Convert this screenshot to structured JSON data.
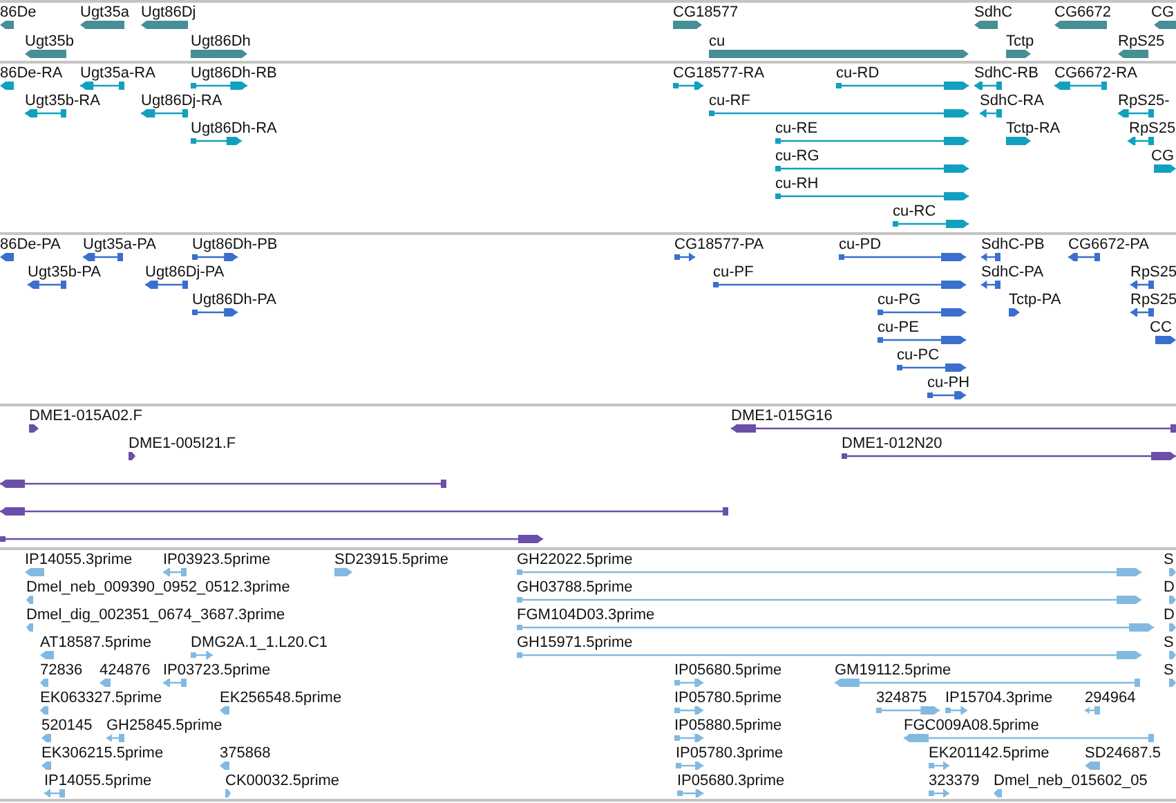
{
  "tracks": [
    {
      "kind": "gene",
      "features": [
        {
          "label": "86De",
          "reverse": true,
          "kind": "block"
        },
        {
          "label": "Ugt35a",
          "reverse": true,
          "kind": "block"
        },
        {
          "label": "Ugt86Dj",
          "reverse": true,
          "kind": "block"
        },
        {
          "label": "CG18577",
          "reverse": false,
          "kind": "block"
        },
        {
          "label": "SdhC",
          "reverse": true,
          "kind": "block"
        },
        {
          "label": "CG6672",
          "reverse": true,
          "kind": "block"
        },
        {
          "label": "CG",
          "reverse": true,
          "kind": "block"
        },
        {
          "label": "Ugt35b",
          "reverse": true,
          "kind": "block"
        },
        {
          "label": "Ugt86Dh",
          "reverse": false,
          "kind": "block"
        },
        {
          "label": "cu",
          "reverse": false,
          "kind": "block"
        },
        {
          "label": "Tctp",
          "reverse": false,
          "kind": "block"
        },
        {
          "label": "RpS25",
          "reverse": true,
          "kind": "block"
        }
      ]
    },
    {
      "kind": "mrna",
      "features": [
        {
          "label": "86De-RA",
          "reverse": true,
          "kind": "block"
        },
        {
          "label": "Ugt35a-RA",
          "reverse": true,
          "kind": "spliced"
        },
        {
          "label": "Ugt86Dh-RB",
          "reverse": false,
          "kind": "spliced"
        },
        {
          "label": "CG18577-RA",
          "reverse": false,
          "kind": "spliced"
        },
        {
          "label": "cu-RD",
          "reverse": false,
          "kind": "spliced"
        },
        {
          "label": "SdhC-RB",
          "reverse": true,
          "kind": "spliced"
        },
        {
          "label": "CG6672-RA",
          "reverse": true,
          "kind": "spliced"
        },
        {
          "label": "Ugt35b-RA",
          "reverse": true,
          "kind": "spliced"
        },
        {
          "label": "Ugt86Dj-RA",
          "reverse": true,
          "kind": "spliced"
        },
        {
          "label": "cu-RF",
          "reverse": false,
          "kind": "spliced"
        },
        {
          "label": "SdhC-RA",
          "reverse": true,
          "kind": "spliced"
        },
        {
          "label": "RpS25-",
          "reverse": true,
          "kind": "spliced"
        },
        {
          "label": "Ugt86Dh-RA",
          "reverse": false,
          "kind": "spliced"
        },
        {
          "label": "cu-RE",
          "reverse": false,
          "kind": "spliced"
        },
        {
          "label": "Tctp-RA",
          "reverse": false,
          "kind": "block"
        },
        {
          "label": "RpS25",
          "reverse": true,
          "kind": "spliced"
        },
        {
          "label": "cu-RG",
          "reverse": false,
          "kind": "spliced"
        },
        {
          "label": "CG",
          "reverse": false,
          "kind": "block"
        },
        {
          "label": "cu-RH",
          "reverse": false,
          "kind": "spliced"
        },
        {
          "label": "cu-RC",
          "reverse": false,
          "kind": "spliced"
        }
      ]
    },
    {
      "kind": "protein",
      "features": [
        {
          "label": "86De-PA",
          "reverse": true,
          "kind": "block"
        },
        {
          "label": "Ugt35a-PA",
          "reverse": true,
          "kind": "spliced"
        },
        {
          "label": "Ugt86Dh-PB",
          "reverse": false,
          "kind": "spliced"
        },
        {
          "label": "CG18577-PA",
          "reverse": false,
          "kind": "spliced"
        },
        {
          "label": "cu-PD",
          "reverse": false,
          "kind": "spliced"
        },
        {
          "label": "SdhC-PB",
          "reverse": true,
          "kind": "spliced"
        },
        {
          "label": "CG6672-PA",
          "reverse": true,
          "kind": "spliced"
        },
        {
          "label": "Ugt35b-PA",
          "reverse": true,
          "kind": "spliced"
        },
        {
          "label": "Ugt86Dj-PA",
          "reverse": true,
          "kind": "spliced"
        },
        {
          "label": "cu-PF",
          "reverse": false,
          "kind": "spliced"
        },
        {
          "label": "SdhC-PA",
          "reverse": true,
          "kind": "spliced"
        },
        {
          "label": "RpS25",
          "reverse": true,
          "kind": "spliced"
        },
        {
          "label": "Ugt86Dh-PA",
          "reverse": false,
          "kind": "spliced"
        },
        {
          "label": "cu-PG",
          "reverse": false,
          "kind": "spliced"
        },
        {
          "label": "Tctp-PA",
          "reverse": false,
          "kind": "block"
        },
        {
          "label": "RpS25",
          "reverse": true,
          "kind": "spliced"
        },
        {
          "label": "cu-PE",
          "reverse": false,
          "kind": "spliced"
        },
        {
          "label": "CC",
          "reverse": false,
          "kind": "block"
        },
        {
          "label": "cu-PC",
          "reverse": false,
          "kind": "spliced"
        },
        {
          "label": "cu-PH",
          "reverse": false,
          "kind": "spliced"
        }
      ]
    },
    {
      "kind": "clone",
      "features": [
        {
          "label": "DME1-015A02.F",
          "reverse": false,
          "kind": "block"
        },
        {
          "label": "DME1-015G16",
          "reverse": true,
          "kind": "spliced"
        },
        {
          "label": "DME1-005I21.F",
          "reverse": false,
          "kind": "block"
        },
        {
          "label": "DME1-012N20",
          "reverse": false,
          "kind": "spliced"
        },
        {
          "reverse": true,
          "kind": "spliced"
        },
        {
          "reverse": true,
          "kind": "spliced"
        },
        {
          "reverse": false,
          "kind": "spliced"
        }
      ]
    },
    {
      "kind": "est",
      "features": [
        {
          "label": "IP14055.3prime",
          "reverse": true,
          "kind": "block"
        },
        {
          "label": "IP03923.5prime",
          "reverse": true,
          "kind": "spliced"
        },
        {
          "label": "SD23915.5prime",
          "reverse": false,
          "kind": "block"
        },
        {
          "label": "GH22022.5prime",
          "reverse": false,
          "kind": "spliced"
        },
        {
          "label": "S",
          "reverse": false,
          "kind": "block"
        },
        {
          "label": "Dmel_neb_009390_0952_0512.3prime",
          "reverse": true,
          "kind": "block"
        },
        {
          "label": "GH03788.5prime",
          "reverse": false,
          "kind": "spliced"
        },
        {
          "label": "D",
          "reverse": false,
          "kind": "block"
        },
        {
          "label": "Dmel_dig_002351_0674_3687.3prime",
          "reverse": true,
          "kind": "block"
        },
        {
          "label": "FGM104D03.3prime",
          "reverse": false,
          "kind": "spliced"
        },
        {
          "label": "D",
          "reverse": false,
          "kind": "block"
        },
        {
          "label": "AT18587.5prime",
          "reverse": true,
          "kind": "block"
        },
        {
          "label": "DMG2A.1_1.L20.C1",
          "reverse": false,
          "kind": "spliced"
        },
        {
          "label": "GH15971.5prime",
          "reverse": false,
          "kind": "spliced"
        },
        {
          "label": "S",
          "reverse": false,
          "kind": "block"
        },
        {
          "label": "72836",
          "reverse": true,
          "kind": "block"
        },
        {
          "label": "424876",
          "reverse": true,
          "kind": "block"
        },
        {
          "label": "IP03723.5prime",
          "reverse": true,
          "kind": "spliced"
        },
        {
          "label": "IP05680.5prime",
          "reverse": false,
          "kind": "spliced"
        },
        {
          "label": "GM19112.5prime",
          "reverse": true,
          "kind": "spliced"
        },
        {
          "label": "S",
          "reverse": false,
          "kind": "block"
        },
        {
          "label": "EK063327.5prime",
          "reverse": true,
          "kind": "block"
        },
        {
          "label": "EK256548.5prime",
          "reverse": true,
          "kind": "block"
        },
        {
          "label": "IP05780.5prime",
          "reverse": false,
          "kind": "spliced"
        },
        {
          "label": "324875",
          "reverse": false,
          "kind": "spliced"
        },
        {
          "label": "IP15704.3prime",
          "reverse": false,
          "kind": "spliced"
        },
        {
          "label": "294964",
          "reverse": true,
          "kind": "spliced"
        },
        {
          "label": "520145",
          "reverse": true,
          "kind": "block"
        },
        {
          "label": "GH25845.5prime",
          "reverse": true,
          "kind": "spliced"
        },
        {
          "label": "IP05880.5prime",
          "reverse": false,
          "kind": "spliced"
        },
        {
          "label": "FGC009A08.5prime",
          "reverse": true,
          "kind": "spliced"
        },
        {
          "label": "EK306215.5prime",
          "reverse": true,
          "kind": "block"
        },
        {
          "label": "375868",
          "reverse": true,
          "kind": "block"
        },
        {
          "label": "IP05780.3prime",
          "reverse": false,
          "kind": "spliced"
        },
        {
          "label": "EK201142.5prime",
          "reverse": false,
          "kind": "spliced"
        },
        {
          "label": "SD24687.5",
          "reverse": true,
          "kind": "block"
        },
        {
          "label": "IP14055.5prime",
          "reverse": true,
          "kind": "spliced"
        },
        {
          "label": "CK00032.5prime",
          "reverse": false,
          "kind": "block"
        },
        {
          "label": "IP05680.3prime",
          "reverse": false,
          "kind": "spliced"
        },
        {
          "label": "323379",
          "reverse": false,
          "kind": "spliced"
        },
        {
          "label": "Dmel_neb_015602_05",
          "reverse": true,
          "kind": "block"
        }
      ]
    }
  ]
}
